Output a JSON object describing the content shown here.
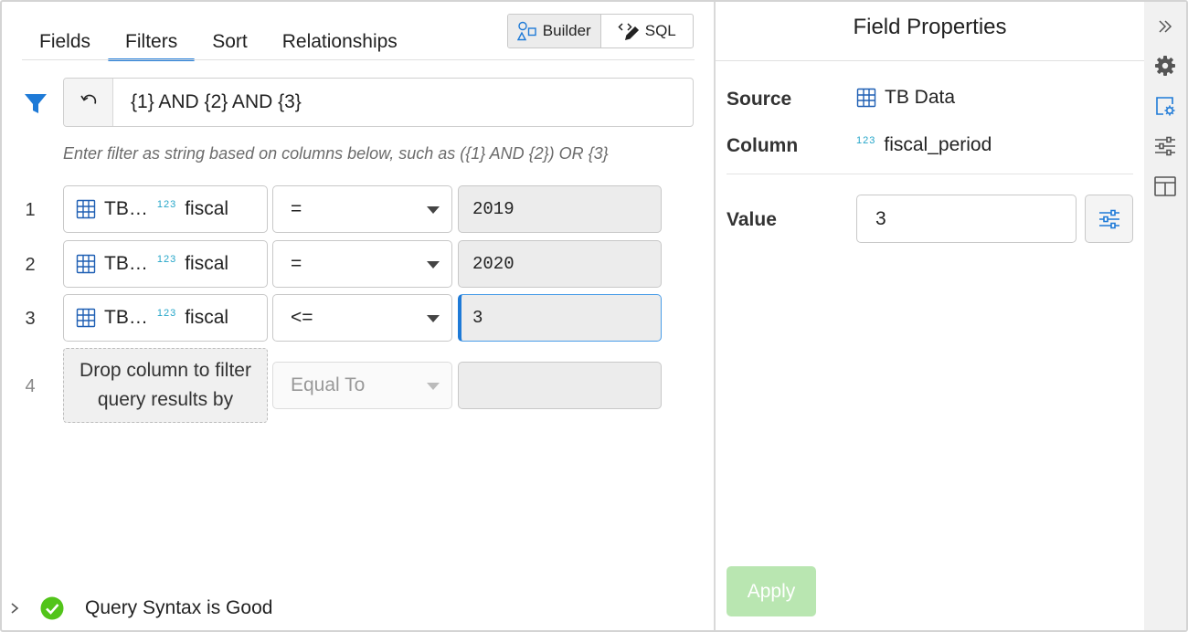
{
  "tabs": [
    {
      "label": "Fields"
    },
    {
      "label": "Filters"
    },
    {
      "label": "Sort"
    },
    {
      "label": "Relationships"
    }
  ],
  "active_tab": "Filters",
  "mode_toggle": {
    "builder_label": "Builder",
    "sql_label": "SQL",
    "active": "Builder"
  },
  "filter_expression": {
    "value": "{1} AND {2} AND {3}"
  },
  "hint": "Enter filter as string based on columns below, such as ({1} AND {2}) OR {3}",
  "filter_rows": [
    {
      "num": "1",
      "column_table": "TB…",
      "column_type": "123",
      "column_name": "fiscal",
      "operator": "=",
      "value": "2019"
    },
    {
      "num": "2",
      "column_table": "TB…",
      "column_type": "123",
      "column_name": "fiscal",
      "operator": "=",
      "value": "2020"
    },
    {
      "num": "3",
      "column_table": "TB…",
      "column_type": "123",
      "column_name": "fiscal",
      "operator": "<=",
      "value": "3"
    }
  ],
  "empty_row": {
    "num": "4",
    "drop_text": "Drop column to filter query results by",
    "operator_placeholder": "Equal To",
    "value": ""
  },
  "status": {
    "text": "Query Syntax is Good",
    "state": "good"
  },
  "field_properties": {
    "title": "Field Properties",
    "source_label": "Source",
    "source_value": "TB Data",
    "column_label": "Column",
    "column_type": "123",
    "column_value": "fiscal_period",
    "value_label": "Value",
    "value": "3",
    "apply_label": "Apply"
  },
  "toolbar_icons": [
    "collapse-icon",
    "settings-gear-icon",
    "field-properties-icon",
    "sliders-icon",
    "layout-panel-icon"
  ],
  "colors": {
    "accent": "#1e7ad7",
    "success": "#52c41a",
    "apply_disabled": "#b9e6b1",
    "type_badge": "#26a6c9"
  }
}
